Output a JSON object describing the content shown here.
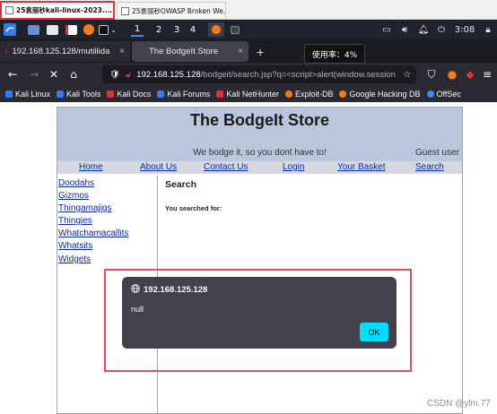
{
  "vm_tabs": [
    {
      "label": "25袁丽秒kali-linux-2023....",
      "close": "×"
    },
    {
      "label": "25袁丽秒OWASP Broken We...",
      "close": "×"
    }
  ],
  "panel": {
    "workspaces": [
      "1",
      "2",
      "3",
      "4"
    ],
    "time": "3:08"
  },
  "firefox_tabs": [
    {
      "label": "192.168.125.128/mutillida",
      "close": "×"
    },
    {
      "label": "The BodgeIt Store",
      "close": "×"
    }
  ],
  "tooltip": "使用率：4%",
  "urlbar": {
    "host": "192.168.125.128",
    "path": "/bodgeit/search.jsp?q=<script>alert(window.session"
  },
  "bookmarks": [
    "Kali Linux",
    "Kali Tools",
    "Kali Docs",
    "Kali Forums",
    "Kali NetHunter",
    "Exploit-DB",
    "Google Hacking DB",
    "OffSec"
  ],
  "store": {
    "title": "The BodgeIt Store",
    "tagline": "We bodge it, so you dont have to!",
    "user": "Guest user",
    "menu": [
      "Home",
      "About Us",
      "Contact Us",
      "Login",
      "Your Basket",
      "Search"
    ],
    "categories": [
      "Doodahs",
      "Gizmos",
      "Thingamajigs",
      "Thingies",
      "Whatchamacallits",
      "Whatsits",
      "Widgets"
    ],
    "search_heading": "Search",
    "searched_label": "You searched for:"
  },
  "alert": {
    "origin": "192.168.125.128",
    "message": "null",
    "ok": "OK"
  },
  "watermark": "CSDN @ylm.77",
  "colors": {
    "alert_button": "#00ddff",
    "annotation_red": "#e0303a",
    "banner": "#bac6dc"
  }
}
